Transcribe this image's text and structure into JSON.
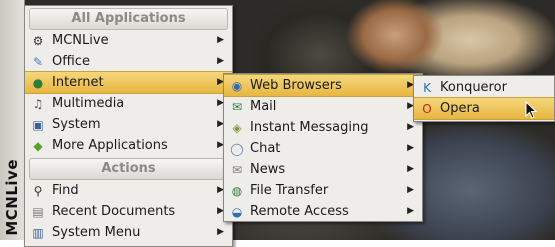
{
  "side_panel": {
    "label": "MCNLive"
  },
  "main_menu": {
    "header_apps": "All Applications",
    "items": [
      {
        "label": "MCNLive",
        "icon": "mcnlive-icon",
        "glyph": "⚙",
        "color": "#333333"
      },
      {
        "label": "Office",
        "icon": "office-icon",
        "glyph": "✎",
        "color": "#4a7ab8"
      },
      {
        "label": "Internet",
        "icon": "globe-icon",
        "glyph": "●",
        "color": "#2f7d3a"
      },
      {
        "label": "Multimedia",
        "icon": "multimedia-icon",
        "glyph": "♫",
        "color": "#555555"
      },
      {
        "label": "System",
        "icon": "system-icon",
        "glyph": "▣",
        "color": "#3b5f9a"
      },
      {
        "label": "More Applications",
        "icon": "more-apps-icon",
        "glyph": "◆",
        "color": "#5aa02c"
      }
    ],
    "header_actions": "Actions",
    "actions": [
      {
        "label": "Find",
        "icon": "search-icon",
        "glyph": "⚲",
        "color": "#333333"
      },
      {
        "label": "Recent Documents",
        "icon": "document-icon",
        "glyph": "▤",
        "color": "#777777"
      },
      {
        "label": "System Menu",
        "icon": "system-menu-icon",
        "glyph": "▥",
        "color": "#3b5f9a"
      }
    ]
  },
  "internet_menu": {
    "items": [
      {
        "label": "Web Browsers",
        "icon": "web-browsers-icon",
        "glyph": "◉",
        "color": "#2f6db3"
      },
      {
        "label": "Mail",
        "icon": "mail-icon",
        "glyph": "✉",
        "color": "#2f7d3a"
      },
      {
        "label": "Instant Messaging",
        "icon": "instant-messaging-icon",
        "glyph": "◈",
        "color": "#7a9a3a"
      },
      {
        "label": "Chat",
        "icon": "chat-icon",
        "glyph": "◯",
        "color": "#5d7fb0"
      },
      {
        "label": "News",
        "icon": "news-icon",
        "glyph": "✉",
        "color": "#7a7a7a"
      },
      {
        "label": "File Transfer",
        "icon": "file-transfer-icon",
        "glyph": "◍",
        "color": "#2f7d3a"
      },
      {
        "label": "Remote Access",
        "icon": "remote-access-icon",
        "glyph": "◒",
        "color": "#2f6db3"
      }
    ]
  },
  "browsers_menu": {
    "items": [
      {
        "label": "Konqueror",
        "icon": "konqueror-icon",
        "glyph": "K",
        "color": "#2f6db3"
      },
      {
        "label": "Opera",
        "icon": "opera-icon",
        "glyph": "O",
        "color": "#c8201f"
      }
    ]
  }
}
